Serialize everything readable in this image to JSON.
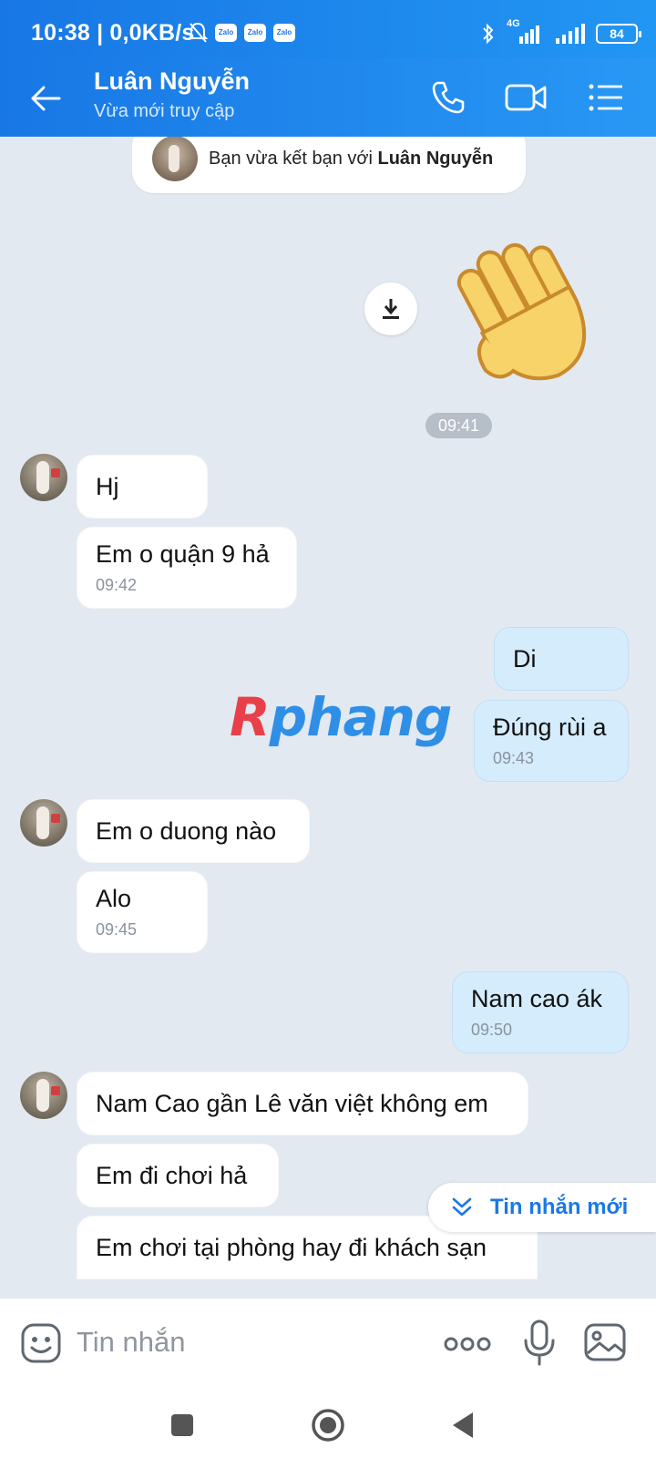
{
  "status_bar": {
    "time_net": "10:38 | 0,0KB/s",
    "zalo_badge": "Zalo",
    "network": "4G",
    "battery": "84"
  },
  "header": {
    "name": "Luân Nguyễn",
    "status": "Vừa mới truy cập",
    "icons": [
      "back-arrow-icon",
      "phone-icon",
      "video-call-icon",
      "menu-list-icon"
    ]
  },
  "chat": {
    "system": {
      "prefix": "Bạn vừa kết bạn với ",
      "name": "Luân Nguyễn"
    },
    "sticker_time": "09:41",
    "messages": [
      {
        "side": "in",
        "text": "Hj",
        "time": ""
      },
      {
        "side": "in",
        "text": "Em o quận 9 hả",
        "time": "09:42"
      },
      {
        "side": "out",
        "text": "Di",
        "time": ""
      },
      {
        "side": "out",
        "text": "Đúng rùi a",
        "time": "09:43"
      },
      {
        "side": "in",
        "text": "Em o duong nào",
        "time": ""
      },
      {
        "side": "in",
        "text": "Alo",
        "time": "09:45"
      },
      {
        "side": "out",
        "text": "Nam cao ák",
        "time": "09:50"
      },
      {
        "side": "in",
        "text": "Nam Cao gần Lê văn việt không em",
        "time": ""
      },
      {
        "side": "in",
        "text": "Em đi chơi hả",
        "time": ""
      },
      {
        "side": "in",
        "text": "Em chơi tại phòng hay đi khách sạn",
        "time": ""
      }
    ],
    "watermark_r": "R",
    "watermark_rest": "phang",
    "new_message_label": "Tin nhắn mới"
  },
  "input": {
    "placeholder": "Tin nhắn"
  },
  "colors": {
    "header_blue": "#1877e5",
    "bubble_out": "#d5ecfd",
    "chat_bg": "#e2e9f1"
  }
}
